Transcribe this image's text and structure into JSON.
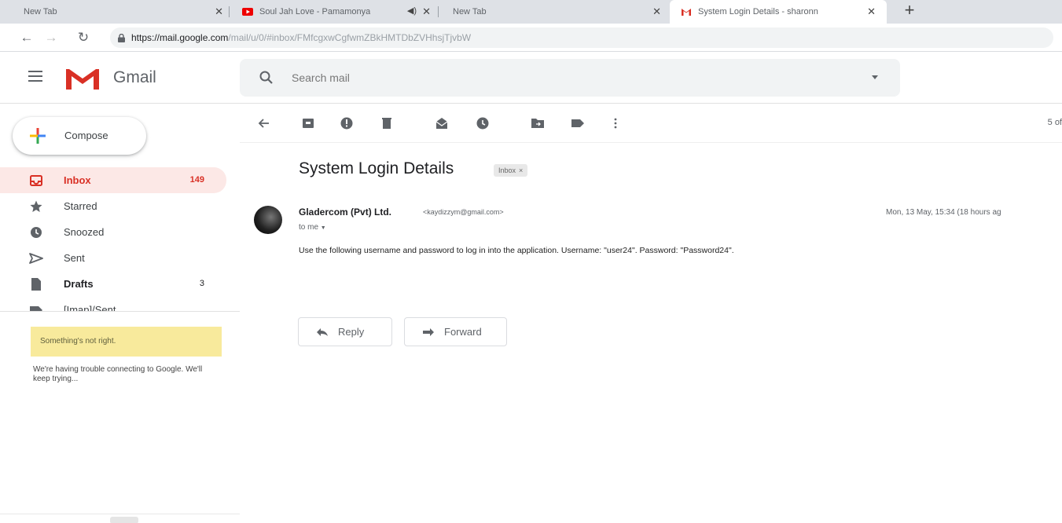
{
  "browser": {
    "tabs": [
      {
        "title": "New Tab"
      },
      {
        "title": "Soul Jah Love - Pamamonya"
      },
      {
        "title": "New Tab"
      },
      {
        "title": "System Login Details - sharonn"
      }
    ],
    "new_tab_symbol": "+",
    "url_domain": "https://mail.google.com",
    "url_path": "/mail/u/0/#inbox/FMfcgxwCgfwmZBkHMTDbZVHhsjTjvbW"
  },
  "header": {
    "app_name": "Gmail",
    "search_placeholder": "Search mail"
  },
  "sidebar": {
    "compose_label": "Compose",
    "items": [
      {
        "label": "Inbox",
        "count": "149",
        "icon": "inbox-icon"
      },
      {
        "label": "Starred",
        "count": "",
        "icon": "star-icon"
      },
      {
        "label": "Snoozed",
        "count": "",
        "icon": "clock-icon"
      },
      {
        "label": "Sent",
        "count": "",
        "icon": "send-icon"
      },
      {
        "label": "Drafts",
        "count": "3",
        "icon": "draft-icon"
      },
      {
        "label": "[Imap]/Sent",
        "count": "",
        "icon": "label-icon"
      }
    ],
    "warning_title": "Something's not right.",
    "warning_detail": "We're having trouble connecting to Google. We'll keep trying..."
  },
  "toolbar": {
    "pager": "5 of"
  },
  "message": {
    "subject": "System Login Details",
    "label_chip": "Inbox",
    "label_chip_close": "×",
    "sender_name": "Gladercom (Pvt) Ltd.",
    "sender_email": "<kaydizzym@gmail.com>",
    "recipient": "to me",
    "date": "Mon, 13 May, 15:34 (18 hours ag",
    "body": "Use the following username and password to log in into the application. Username: \"user24\". Password: \"Password24\".",
    "reply_label": "Reply",
    "forward_label": "Forward"
  },
  "colors": {
    "accent_red": "#d93025",
    "inbox_highlight": "#fce8e6",
    "warning_bg": "#f8ea9c"
  }
}
